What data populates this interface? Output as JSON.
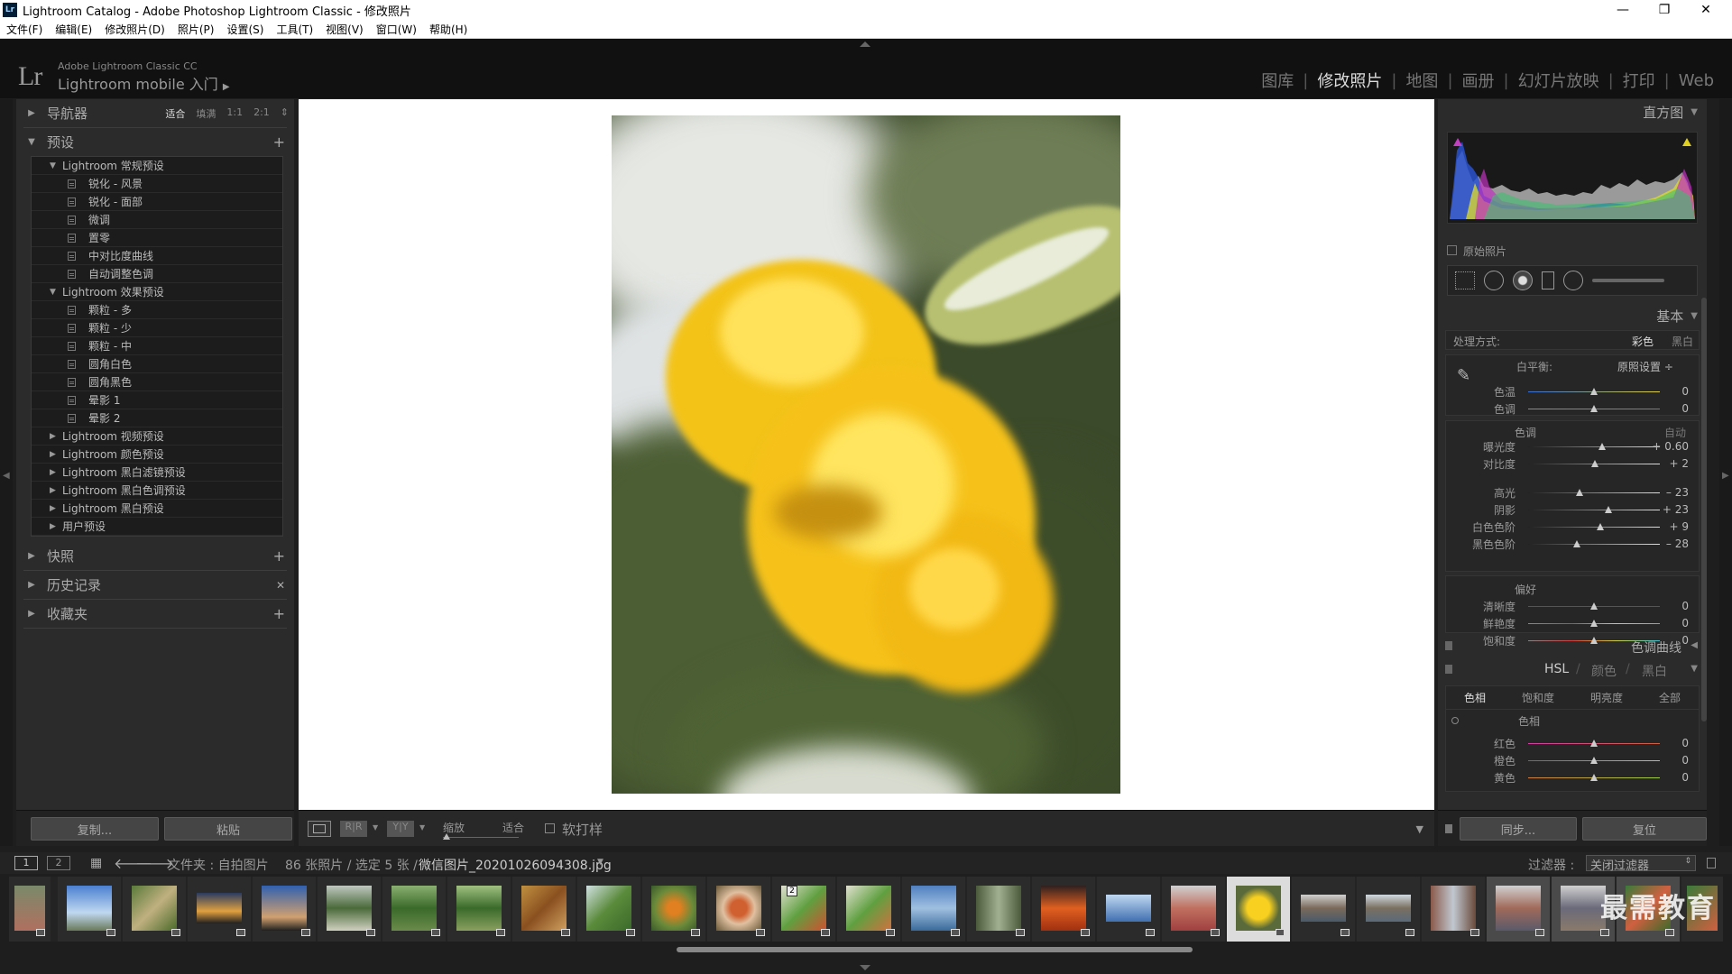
{
  "window": {
    "title": "Lightroom Catalog - Adobe Photoshop Lightroom Classic - 修改照片",
    "app_icon": "Lr"
  },
  "menu": [
    "文件(F)",
    "编辑(E)",
    "修改照片(D)",
    "照片(P)",
    "设置(S)",
    "工具(T)",
    "视图(V)",
    "窗口(W)",
    "帮助(H)"
  ],
  "identity": {
    "logo": "Lr",
    "line1": "Adobe Lightroom Classic CC",
    "line2": "Lightroom mobile 入门",
    "arrow": "▶"
  },
  "modules": [
    {
      "label": "图库",
      "active": false
    },
    {
      "label": "修改照片",
      "active": true
    },
    {
      "label": "地图",
      "active": false
    },
    {
      "label": "画册",
      "active": false
    },
    {
      "label": "幻灯片放映",
      "active": false
    },
    {
      "label": "打印",
      "active": false
    },
    {
      "label": "Web",
      "active": false
    }
  ],
  "left": {
    "navigator": {
      "title": "导航器",
      "opts": [
        "适合",
        "填满",
        "1:1",
        "2:1"
      ]
    },
    "presets": {
      "title": "预设",
      "groups": [
        {
          "label": "Lightroom 常规预设",
          "open": true,
          "items": [
            "锐化 - 风景",
            "锐化 - 面部",
            "微调",
            "置零",
            "中对比度曲线",
            "自动调整色调"
          ]
        },
        {
          "label": "Lightroom 效果预设",
          "open": true,
          "items": [
            "颗粒 - 多",
            "颗粒 - 少",
            "颗粒 - 中",
            "圆角白色",
            "圆角黑色",
            "晕影 1",
            "晕影 2"
          ]
        },
        {
          "label": "Lightroom 视频预设",
          "open": false,
          "items": []
        },
        {
          "label": "Lightroom 颜色预设",
          "open": false,
          "items": []
        },
        {
          "label": "Lightroom 黑白滤镜预设",
          "open": false,
          "items": []
        },
        {
          "label": "Lightroom 黑白色调预设",
          "open": false,
          "items": []
        },
        {
          "label": "Lightroom 黑白预设",
          "open": false,
          "items": []
        },
        {
          "label": "用户预设",
          "open": false,
          "items": []
        }
      ]
    },
    "snapshots": "快照",
    "history": "历史记录",
    "collections": "收藏夹",
    "copy_btn": "复制...",
    "paste_btn": "粘贴"
  },
  "toolbar": {
    "zoom_label": "缩放",
    "zoom_value": "适合",
    "softproof": "软打样"
  },
  "right": {
    "histogram": "直方图",
    "original_photo": "原始照片",
    "basic": "基本",
    "treatment_label": "处理方式:",
    "treatment_color": "彩色",
    "treatment_bw": "黑白",
    "wb_label": "白平衡:",
    "wb_value": "原照设置 ÷",
    "tone_label": "色调",
    "auto_label": "自动",
    "presence_label": "偏好",
    "sliders_wb": [
      {
        "label": "色温",
        "value": "0",
        "pos": 0.5,
        "grad": "linear-gradient(90deg,#3a6fd0,#e0d040)"
      },
      {
        "label": "色调",
        "value": "0",
        "pos": 0.5,
        "grad": "linear-gradient(90deg,#40c040,#d040d0)"
      }
    ],
    "sliders_tone1": [
      {
        "label": "曝光度",
        "value": "+ 0.60",
        "pos": 0.56
      },
      {
        "label": "对比度",
        "value": "+ 2",
        "pos": 0.51
      }
    ],
    "sliders_tone2": [
      {
        "label": "高光",
        "value": "– 23",
        "pos": 0.39
      },
      {
        "label": "阴影",
        "value": "+ 23",
        "pos": 0.61
      },
      {
        "label": "白色色阶",
        "value": "+ 9",
        "pos": 0.55
      },
      {
        "label": "黑色色阶",
        "value": "– 28",
        "pos": 0.37
      }
    ],
    "sliders_presence": [
      {
        "label": "清晰度",
        "value": "0",
        "pos": 0.5,
        "grad": "#555"
      },
      {
        "label": "鲜艳度",
        "value": "0",
        "pos": 0.5,
        "grad": "linear-gradient(90deg,#888,#d04040,#d0d040,#40c0d0)"
      },
      {
        "label": "饱和度",
        "value": "0",
        "pos": 0.5,
        "grad": "linear-gradient(90deg,#888,#d04040,#d0d040,#40c0d0)"
      }
    ],
    "tone_curve": "色调曲线",
    "hsl_tabs": [
      "HSL",
      "颜色",
      "黑白"
    ],
    "hsl_subtabs": [
      "色相",
      "饱和度",
      "明亮度",
      "全部"
    ],
    "hsl_group": "色相",
    "sliders_hsl": [
      {
        "label": "红色",
        "value": "0",
        "pos": 0.5,
        "grad": "linear-gradient(90deg,#d040a0,#d06040)"
      },
      {
        "label": "橙色",
        "value": "0",
        "pos": 0.5,
        "grad": "linear-gradient(90deg,#d04040,#d0c040)"
      },
      {
        "label": "黄色",
        "value": "0",
        "pos": 0.5,
        "grad": "linear-gradient(90deg,#d08040,#a0d040)"
      }
    ],
    "sync_btn": "同步...",
    "reset_btn": "复位"
  },
  "filmstrip": {
    "page1": "1",
    "page2": "2",
    "source": "文件夹 : 自拍图片",
    "count": "86 张照片 / 选定 5 张 /",
    "filename": "微信图片_20201026094308.jpg",
    "filter_label": "过滤器 :",
    "filter_value": "关闭过滤器",
    "badge2": "2",
    "watermark": "最需教育"
  }
}
